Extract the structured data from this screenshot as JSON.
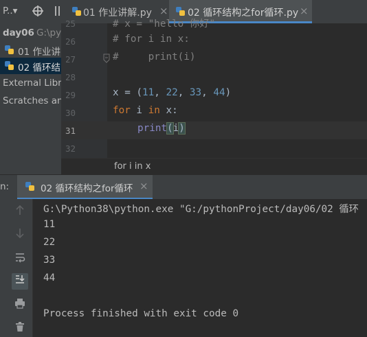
{
  "project_panel": {
    "header_label": "P..▾",
    "root_name": "day06",
    "root_path": "G:\\py",
    "files": [
      "01 作业讲",
      "02 循环结"
    ],
    "external_libraries": "External Libra",
    "scratches": "Scratches anc"
  },
  "tabs": [
    {
      "label": "01 作业讲解.py",
      "active": false
    },
    {
      "label": "02 循环结构之for循环.py",
      "active": true
    }
  ],
  "editor": {
    "line_numbers": [
      "25",
      "26",
      "27",
      "28",
      "29",
      "30",
      "31",
      "32"
    ],
    "current_line": "31",
    "lines": {
      "l25": "# x = \"hello 你好\"",
      "l26": "# for i in x:",
      "l27": "#     print(i)",
      "l29_var": "x",
      "l29_eq": " = (",
      "l29_n1": "11",
      "l29_n2": "22",
      "l29_n3": "33",
      "l29_n4": "44",
      "l29_sep": ", ",
      "l29_close": ")",
      "l30_for": "for",
      "l30_mid": " i ",
      "l30_in": "in",
      "l30_end": " x:",
      "l31_fn": "print",
      "l31_open": "(",
      "l31_arg": "i",
      "l31_close": ")"
    },
    "breadcrumb": "for i in x"
  },
  "run_panel": {
    "prefix": "n:",
    "tab_label": "02 循环结构之for循环",
    "close": "×",
    "console_lines": [
      "G:\\Python38\\python.exe \"G:/pythonProject/day06/02 循环",
      "11",
      "22",
      "33",
      "44",
      "",
      "Process finished with exit code 0"
    ]
  },
  "colors": {
    "accent": "#4a88c7",
    "python_blue": "#3f7fbf",
    "python_yellow": "#f0c040"
  }
}
